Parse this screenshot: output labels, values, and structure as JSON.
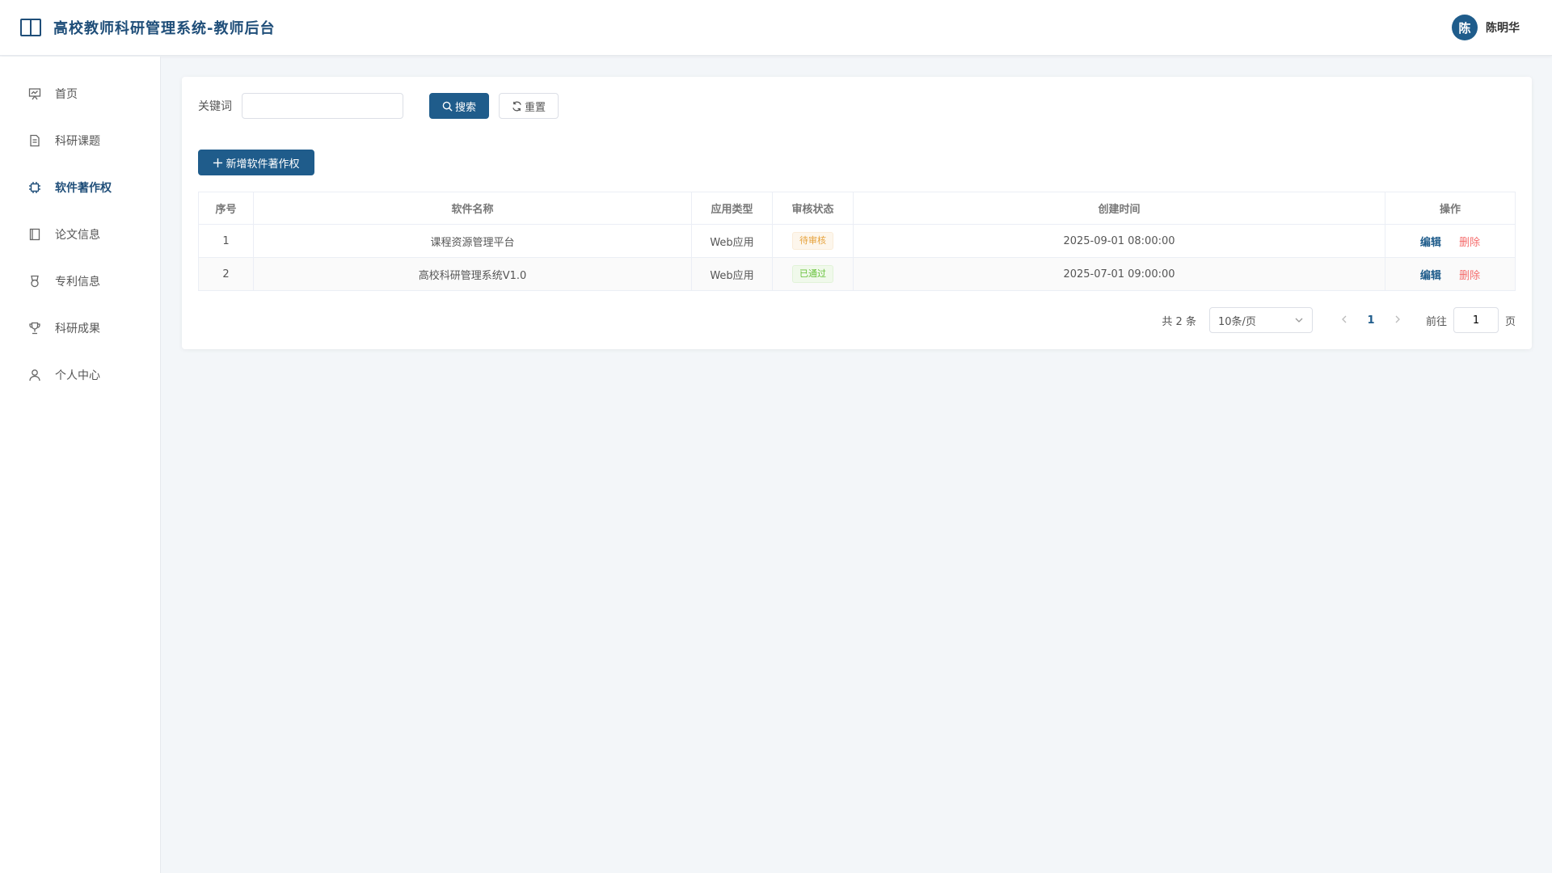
{
  "header": {
    "title": "高校教师科研管理系统-教师后台",
    "user": {
      "avatar_text": "陈",
      "name": "陈明华"
    }
  },
  "sidebar": {
    "items": [
      {
        "label": "首页",
        "icon": "presentation-icon",
        "active": false
      },
      {
        "label": "科研课题",
        "icon": "document-icon",
        "active": false
      },
      {
        "label": "软件著作权",
        "icon": "chip-icon",
        "active": true
      },
      {
        "label": "论文信息",
        "icon": "notebook-icon",
        "active": false
      },
      {
        "label": "专利信息",
        "icon": "medal-icon",
        "active": false
      },
      {
        "label": "科研成果",
        "icon": "trophy-icon",
        "active": false
      },
      {
        "label": "个人中心",
        "icon": "user-icon",
        "active": false
      }
    ]
  },
  "search": {
    "label": "关键词",
    "value": "",
    "placeholder": "",
    "search_label": "搜索",
    "reset_label": "重置"
  },
  "toolbar": {
    "add_label": "新增软件著作权"
  },
  "table": {
    "columns": [
      "序号",
      "软件名称",
      "应用类型",
      "审核状态",
      "创建时间",
      "操作"
    ],
    "rows": [
      {
        "index": "1",
        "name": "课程资源管理平台",
        "type": "Web应用",
        "status": "待审核",
        "status_kind": "warning",
        "created": "2025-09-01 08:00:00",
        "edit": "编辑",
        "delete": "删除"
      },
      {
        "index": "2",
        "name": "高校科研管理系统V1.0",
        "type": "Web应用",
        "status": "已通过",
        "status_kind": "success",
        "created": "2025-07-01 09:00:00",
        "edit": "编辑",
        "delete": "删除"
      }
    ]
  },
  "pagination": {
    "total_text": "共 2 条",
    "page_size": "10条/页",
    "current_page": "1",
    "goto_label": "前往",
    "goto_value": "1",
    "page_unit": "页"
  },
  "colors": {
    "primary": "#1f5c8b",
    "brand_text": "#1f4e79",
    "danger": "#f56c6c",
    "warning": "#e6a23c",
    "success": "#67c23a"
  }
}
